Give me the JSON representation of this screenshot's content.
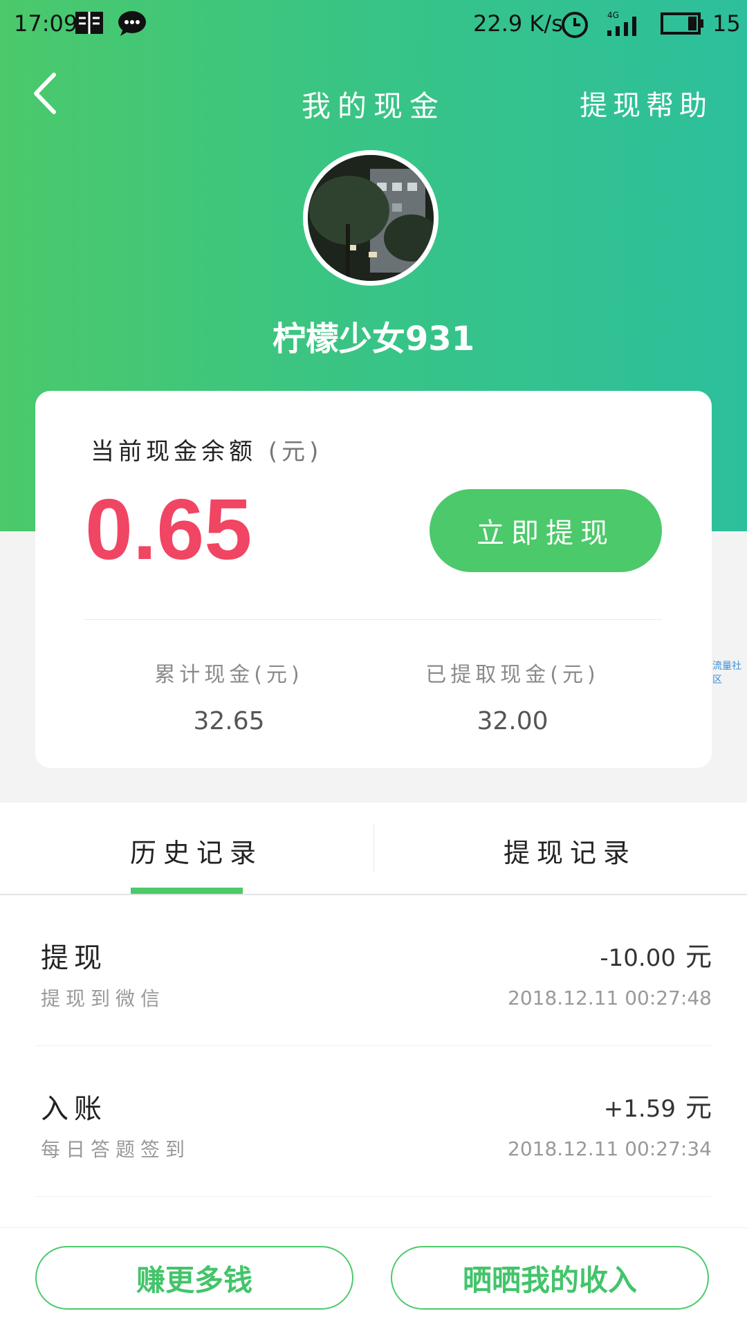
{
  "colors": {
    "accent": "#4cc96a",
    "balance": "#f04563",
    "header_start": "#4bc96b",
    "header_end": "#2dbf9c"
  },
  "status_bar": {
    "time": "17:09",
    "speed": "22.9 K/s",
    "battery": "15"
  },
  "nav": {
    "title": "我的现金",
    "help": "提现帮助",
    "back_icon": "chevron-left-icon"
  },
  "user": {
    "name": "柠檬少女931"
  },
  "balance": {
    "label": "当前现金余额",
    "unit": "(元)",
    "value": "0.65",
    "withdraw_button": "立即提现"
  },
  "stats": {
    "total_label": "累计现金",
    "total_unit": "(元)",
    "total_value": "32.65",
    "withdrawn_label": "已提取现金",
    "withdrawn_unit": "(元)",
    "withdrawn_value": "32.00"
  },
  "watermark": "流量社区",
  "tabs": {
    "history": "历史记录",
    "withdraw_records": "提现记录",
    "active": "history"
  },
  "records": [
    {
      "title": "提现",
      "desc": "提现到微信",
      "amount": "-10.00",
      "unit": "元",
      "time": "2018.12.11 00:27:48"
    },
    {
      "title": "入账",
      "desc": "每日答题签到",
      "amount": "+1.59",
      "unit": "元",
      "time": "2018.12.11 00:27:34"
    }
  ],
  "bottom": {
    "earn_more": "赚更多钱",
    "share_income": "晒晒我的收入"
  }
}
